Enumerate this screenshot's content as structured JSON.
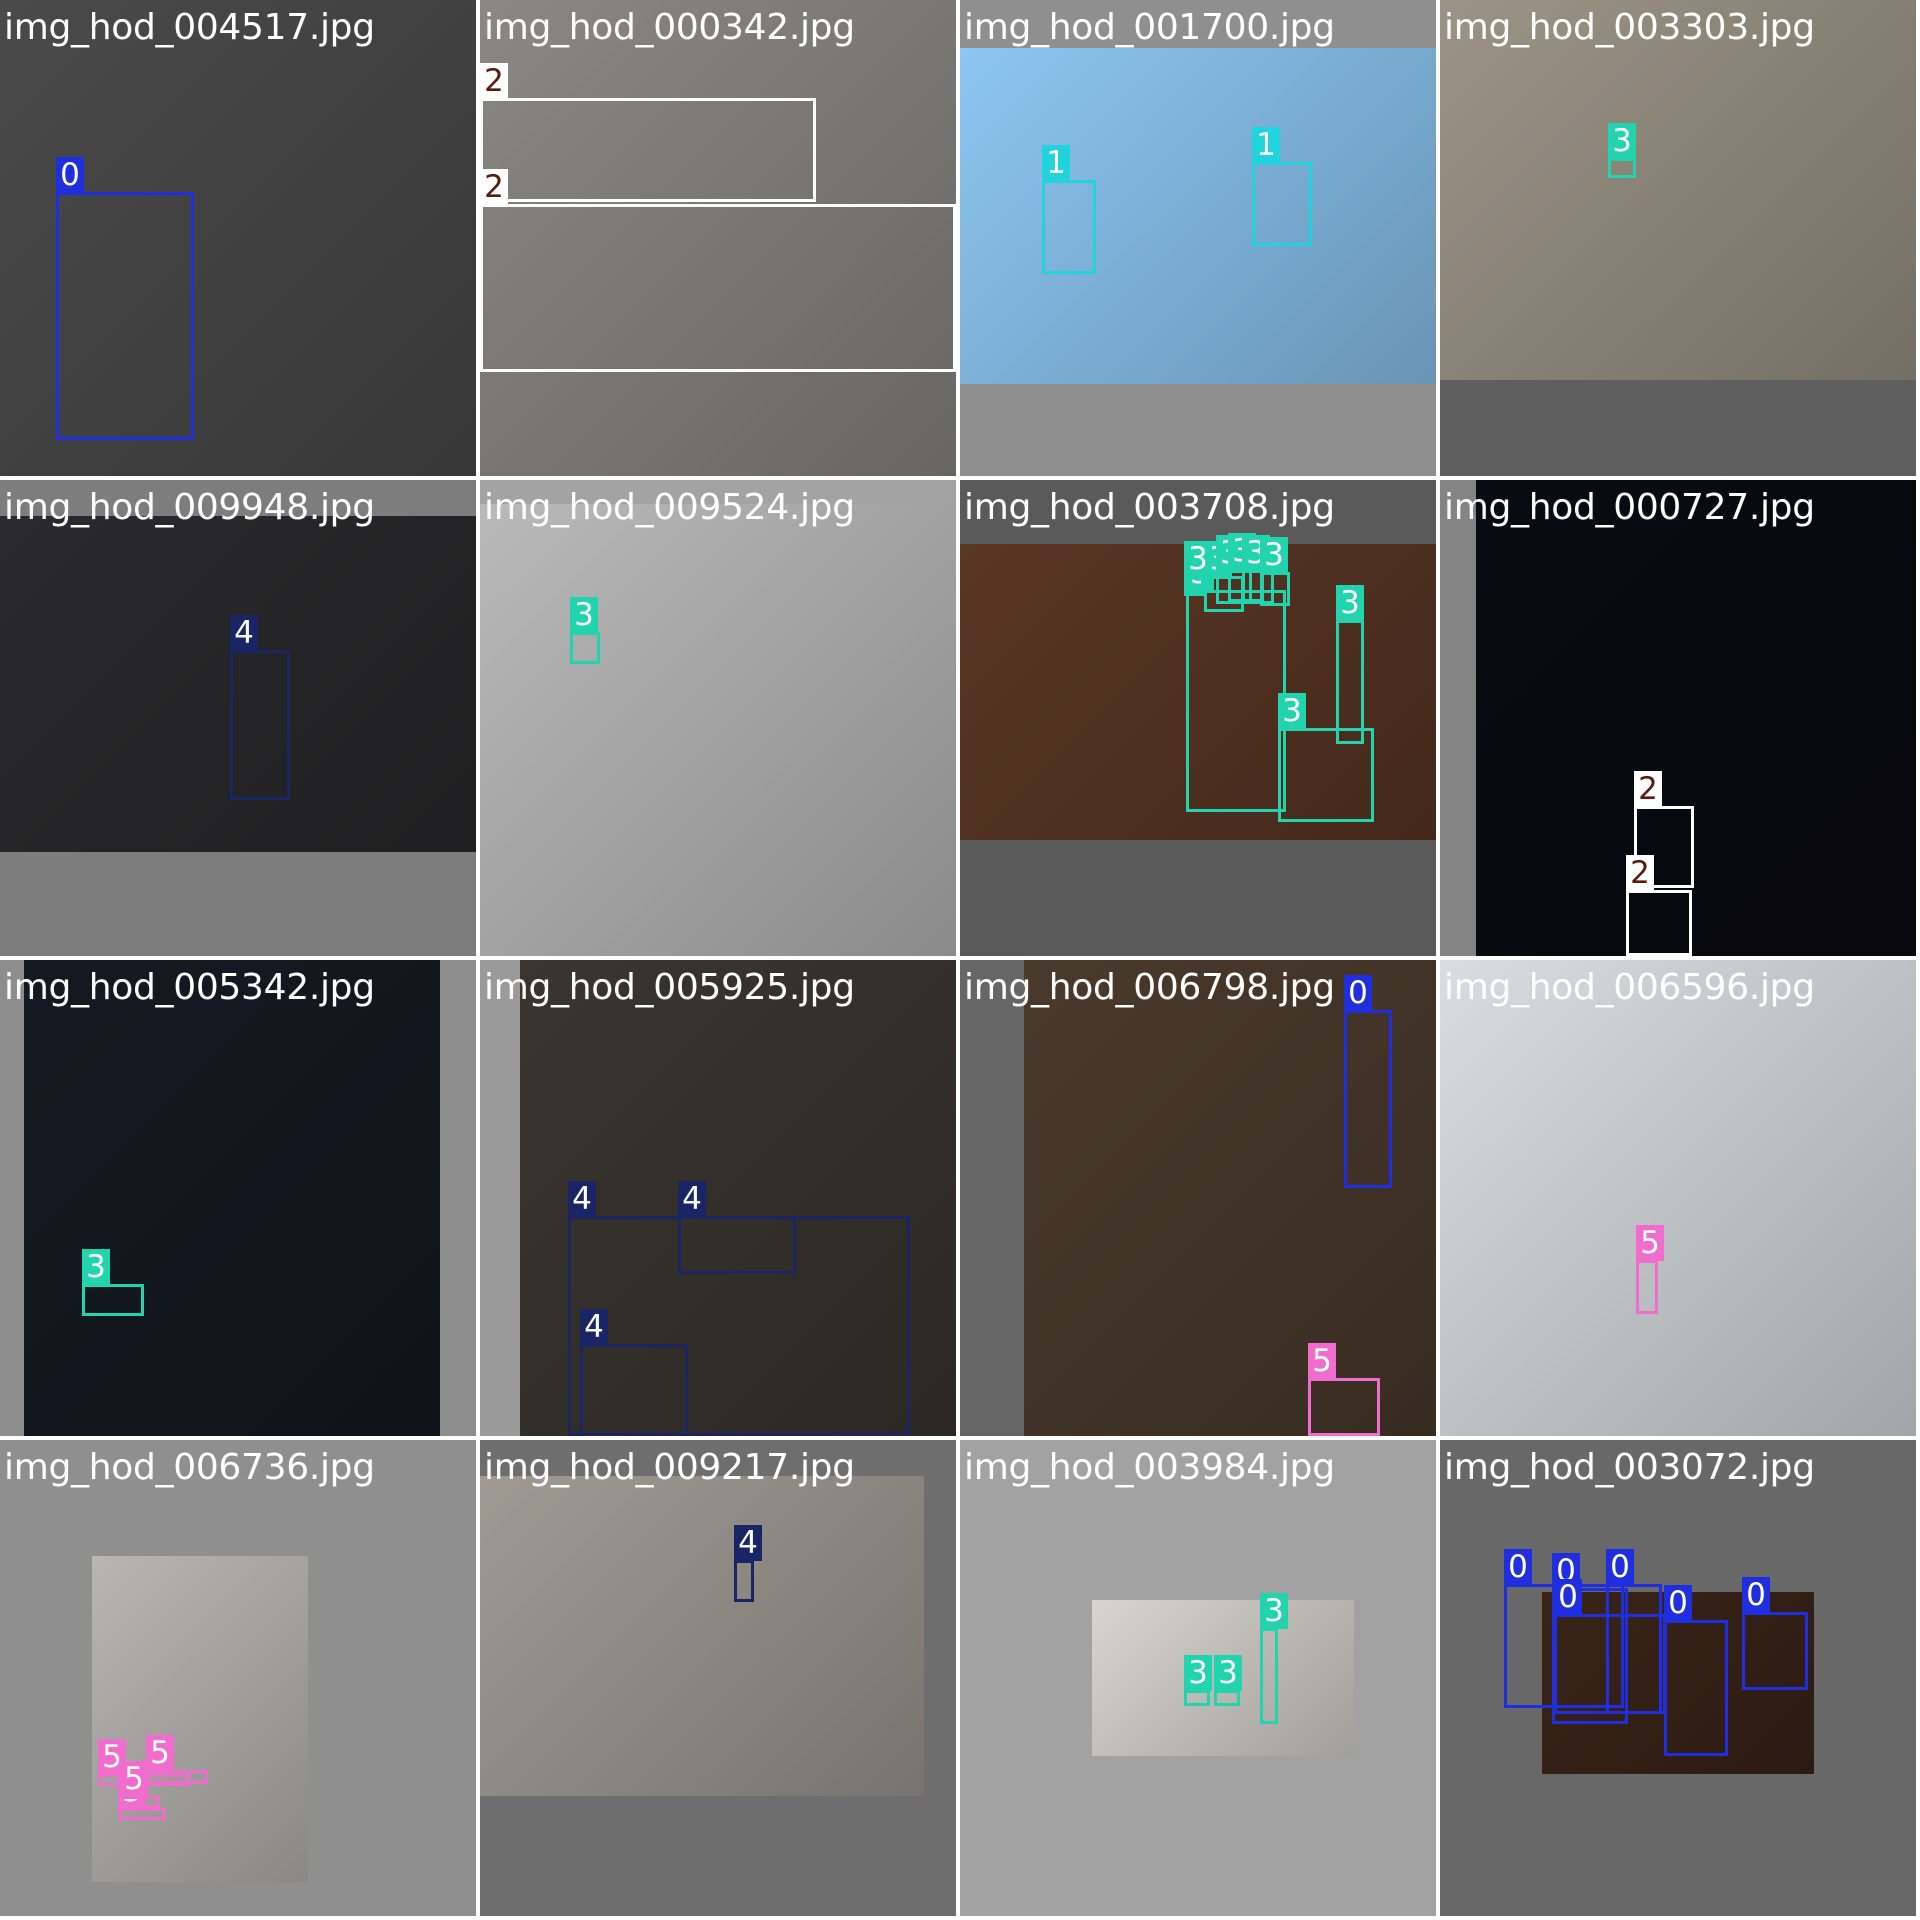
{
  "mosaic": {
    "tiles": [
      {
        "file": "img_hod_004517.jpg",
        "bg": "#7a7a7a",
        "photo": "#4a4a4a",
        "boxes": [
          {
            "cls": "0"
          }
        ]
      },
      {
        "file": "img_hod_000342.jpg",
        "bg": "#6a6a6a",
        "photo": "#8a8885",
        "boxes": [
          {
            "cls": "2"
          },
          {
            "cls": "2"
          }
        ]
      },
      {
        "file": "img_hod_001700.jpg",
        "bg": "#8f8f8f",
        "photo": "#8cc6f2",
        "boxes": [
          {
            "cls": "1"
          },
          {
            "cls": "1"
          }
        ]
      },
      {
        "file": "img_hod_003303.jpg",
        "bg": "#5f5f5f",
        "photo": "#9b9486",
        "boxes": [
          {
            "cls": "3"
          }
        ]
      },
      {
        "file": "img_hod_009948.jpg",
        "bg": "#7d7d7d",
        "photo": "#2a2a2c",
        "boxes": [
          {
            "cls": "4"
          }
        ]
      },
      {
        "file": "img_hod_009524.jpg",
        "bg": "#a3a3a3",
        "photo": "#b9b9b9",
        "boxes": [
          {
            "cls": "3"
          }
        ]
      },
      {
        "file": "img_hod_003708.jpg",
        "bg": "#5a5a5a",
        "photo": "#5a3624",
        "boxes": [
          {
            "cls": "3"
          },
          {
            "cls": "3"
          },
          {
            "cls": "3"
          },
          {
            "cls": "3"
          },
          {
            "cls": "3"
          },
          {
            "cls": "3"
          },
          {
            "cls": "3"
          },
          {
            "cls": "3"
          },
          {
            "cls": "3"
          }
        ]
      },
      {
        "file": "img_hod_000727.jpg",
        "bg": "#848484",
        "photo": "#0a0a12",
        "boxes": [
          {
            "cls": "2"
          },
          {
            "cls": "2"
          }
        ]
      },
      {
        "file": "img_hod_005342.jpg",
        "bg": "#8d8d8d",
        "photo": "#151a22",
        "boxes": [
          {
            "cls": "3"
          }
        ]
      },
      {
        "file": "img_hod_005925.jpg",
        "bg": "#9a9a9a",
        "photo": "#3a3530",
        "boxes": [
          {
            "cls": "4"
          },
          {
            "cls": "4"
          },
          {
            "cls": "4"
          }
        ]
      },
      {
        "file": "img_hod_006798.jpg",
        "bg": "#666666",
        "photo": "#4a3a2c",
        "boxes": [
          {
            "cls": "0"
          },
          {
            "cls": "5"
          }
        ]
      },
      {
        "file": "img_hod_006596.jpg",
        "bg": "#9e9e9e",
        "photo": "#d9dde0",
        "boxes": [
          {
            "cls": "5"
          }
        ]
      },
      {
        "file": "img_hod_006736.jpg",
        "bg": "#8f8f8f",
        "photo": "#b8b6b2",
        "boxes": [
          {
            "cls": "5"
          },
          {
            "cls": "5"
          },
          {
            "cls": "5"
          },
          {
            "cls": "5"
          }
        ]
      },
      {
        "file": "img_hod_009217.jpg",
        "bg": "#6e6e6e",
        "photo": "#a09a93",
        "boxes": [
          {
            "cls": "4"
          }
        ]
      },
      {
        "file": "img_hod_003984.jpg",
        "bg": "#a2a2a2",
        "photo": "#d8d4cf",
        "boxes": [
          {
            "cls": "3"
          },
          {
            "cls": "3"
          },
          {
            "cls": "3"
          }
        ]
      },
      {
        "file": "img_hod_003072.jpg",
        "bg": "#686868",
        "photo": "#3a2418",
        "boxes": [
          {
            "cls": "0"
          },
          {
            "cls": "0"
          },
          {
            "cls": "0"
          },
          {
            "cls": "0"
          },
          {
            "cls": "0"
          },
          {
            "cls": "0"
          }
        ]
      }
    ]
  },
  "class_colors": {
    "0": "#1f2fe0",
    "1": "#21d3dd",
    "2": "#ffffff",
    "3": "#21d4ae",
    "4": "#1a2566",
    "5": "#f06ccd"
  },
  "class_label_bg": {
    "0": "#1f2fe0",
    "1": "#21d3dd",
    "2": "#ffffff",
    "3": "#21d4ae",
    "4": "#1a2566",
    "5": "#f06ccd"
  },
  "class_label_text": {
    "0": "#ffffff",
    "1": "#ffffff",
    "2": "#5a1a10",
    "3": "#ffffff",
    "4": "#ffffff",
    "5": "#ffffff"
  }
}
